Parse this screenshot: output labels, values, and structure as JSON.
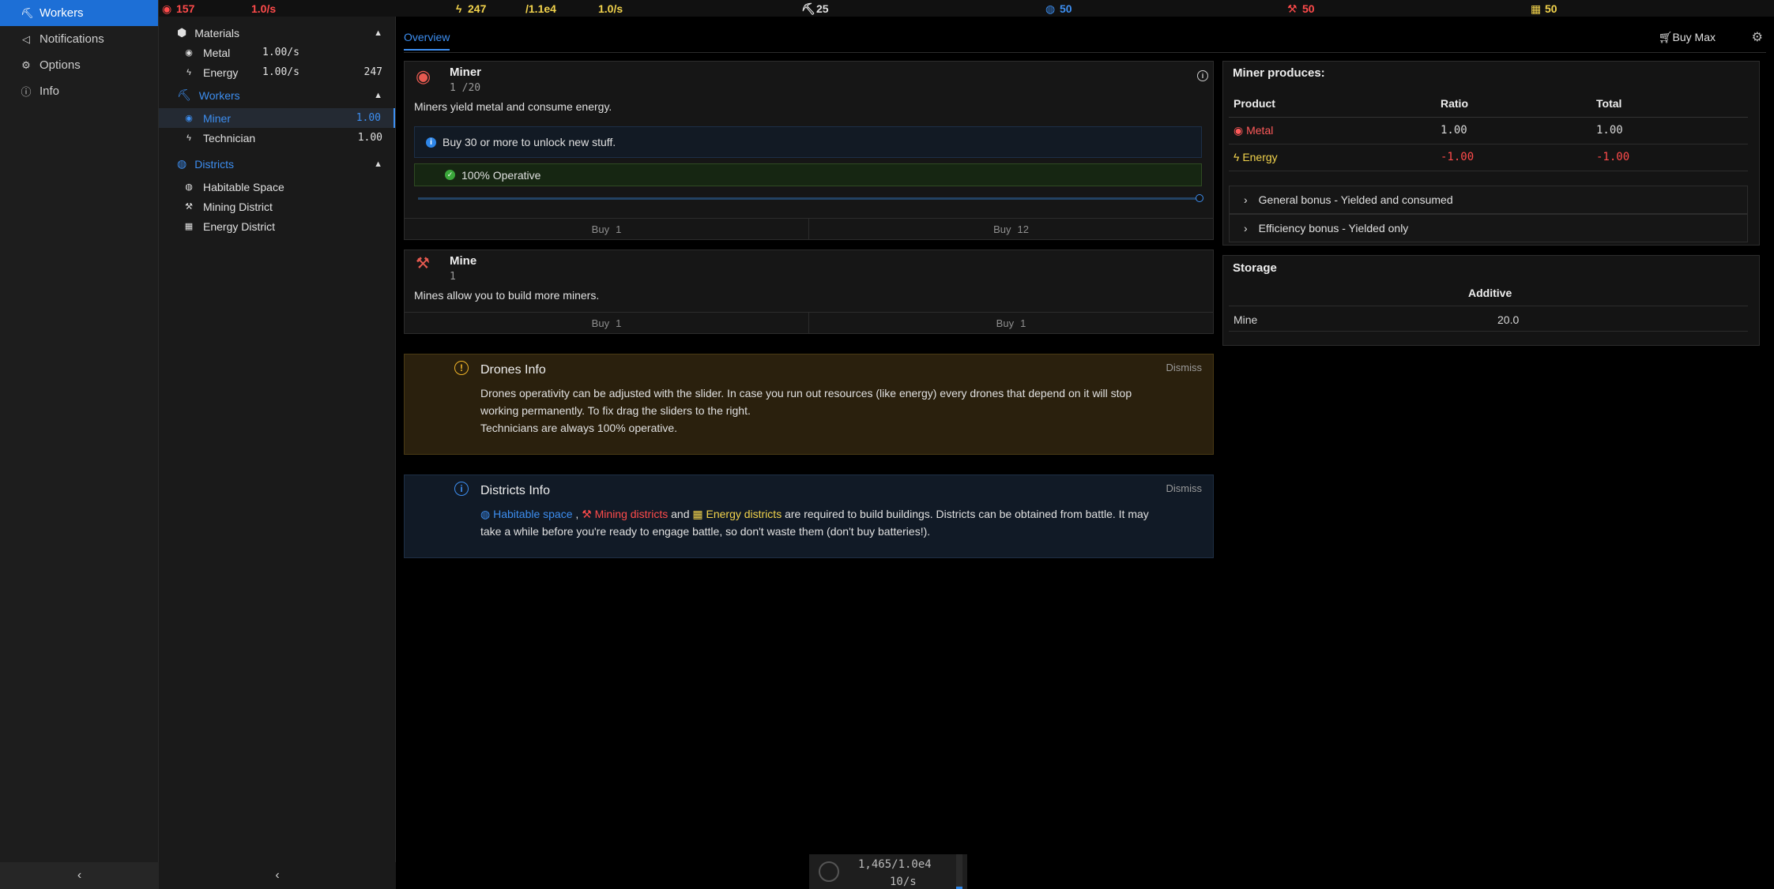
{
  "nav": {
    "items": [
      {
        "label": "Workers",
        "icon": "workers-icon",
        "active": true
      },
      {
        "label": "Notifications",
        "icon": "megaphone-icon",
        "active": false
      },
      {
        "label": "Options",
        "icon": "gear-icon",
        "active": false
      },
      {
        "label": "Info",
        "icon": "info-icon",
        "active": false
      }
    ]
  },
  "topbar": {
    "metal": "157",
    "metal_rate": "1.0/s",
    "energy": "247",
    "energy_cap": "/1.1e4",
    "energy_rate": "1.0/s",
    "drones": "25",
    "habitable": "50",
    "mining": "50",
    "energy_district": "50",
    "colors": {
      "red": "#ff4b4b",
      "yellow": "#f2d34c",
      "blue": "#3d8ef0",
      "white": "#e0e0e0"
    }
  },
  "sub": {
    "materials": {
      "heading": "Materials",
      "items": [
        {
          "label": "Metal",
          "rate": "1.00/s",
          "amount": ""
        },
        {
          "label": "Energy",
          "rate": "1.00/s",
          "amount": "247"
        }
      ]
    },
    "workers": {
      "heading": "Workers",
      "items": [
        {
          "label": "Miner",
          "value": "1.00"
        },
        {
          "label": "Technician",
          "value": "1.00"
        }
      ]
    },
    "districts": {
      "heading": "Districts",
      "items": [
        {
          "label": "Habitable Space"
        },
        {
          "label": "Mining District"
        },
        {
          "label": "Energy District"
        }
      ]
    }
  },
  "main": {
    "tab": "Overview",
    "buy_max": "Buy Max",
    "miner": {
      "title": "Miner",
      "count": "1 /20",
      "desc": "Miners yield metal and consume energy.",
      "notice": "Buy 30 or more to unlock new stuff.",
      "operative": "100% Operative",
      "operativity": 1.0,
      "buy1_label": "Buy",
      "buy1_qty": "1",
      "buy2_label": "Buy",
      "buy2_qty": "12"
    },
    "mine": {
      "title": "Mine",
      "count": "1",
      "desc": "Mines allow you to build more miners.",
      "buy1_label": "Buy",
      "buy1_qty": "1",
      "buy2_label": "Buy",
      "buy2_qty": "1"
    },
    "drones_info": {
      "title": "Drones Info",
      "dismiss": "Dismiss",
      "line1": "Drones operativity can be adjusted with the slider. In case you run out resources (like energy) every drones that depend on it will stop",
      "line2": "working permanently. To fix drag the sliders to the right.",
      "line3": "Technicians are always 100% operative."
    },
    "districts_info": {
      "title": "Districts Info",
      "dismiss": "Dismiss",
      "habitable": "Habitable space",
      "sep1": " ,",
      "mining": "Mining districts",
      "and": " and ",
      "energy": "Energy districts",
      "rest1": " are required to build buildings. Districts can be obtained from battle. It may",
      "line2": "take a while before you're ready to engage battle, so don't waste them (don't buy batteries!)."
    },
    "produces": {
      "title": "Miner produces:",
      "headers": [
        "Product",
        "Ratio",
        "Total"
      ],
      "rows": [
        {
          "product": "Metal",
          "ratio": "1.00",
          "total": "1.00"
        },
        {
          "product": "Energy",
          "ratio": "-1.00",
          "total": "-1.00"
        }
      ],
      "bonus1": "General bonus - Yielded and consumed",
      "bonus2": "Efficiency bonus - Yielded only"
    },
    "storage": {
      "title": "Storage",
      "header": "Additive",
      "row_label": "Mine",
      "row_value": "20.0"
    }
  },
  "footer": {
    "line1": "1,465/1.0e4",
    "line2": "10/s"
  }
}
